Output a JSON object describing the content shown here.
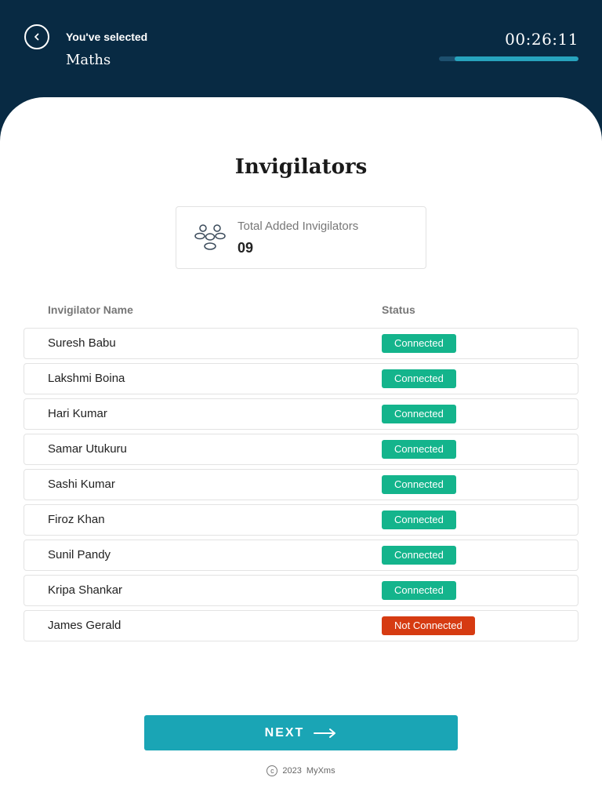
{
  "header": {
    "selected_label": "You've selected",
    "subject": "Maths",
    "timer": "00:26:11",
    "progress": 0.89,
    "back_icon": "chevron-left-icon"
  },
  "page": {
    "title": "Invigilators"
  },
  "summary": {
    "label": "Total Added Invigilators",
    "count": "09",
    "icon": "group-icon"
  },
  "table": {
    "columns": [
      "Invigilator Name",
      "Status"
    ],
    "rows": [
      {
        "name": "Suresh Babu",
        "status": "Connected"
      },
      {
        "name": "Lakshmi Boina",
        "status": "Connected"
      },
      {
        "name": "Hari Kumar",
        "status": "Connected"
      },
      {
        "name": "Samar Utukuru",
        "status": "Connected"
      },
      {
        "name": "Sashi Kumar",
        "status": "Connected"
      },
      {
        "name": "Firoz Khan",
        "status": "Connected"
      },
      {
        "name": "Sunil Pandy",
        "status": "Connected"
      },
      {
        "name": "Kripa Shankar",
        "status": "Connected"
      },
      {
        "name": "James Gerald",
        "status": "Not Connected"
      }
    ]
  },
  "colors": {
    "connected": "#14b48c",
    "not_connected": "#d63b12",
    "accent": "#1aa5b5",
    "header_bg": "#082a43"
  },
  "next_button": {
    "label": "NEXT",
    "icon": "arrow-right-icon"
  },
  "footer": {
    "icon": "copyright-icon",
    "year": "2023",
    "brand": "MyXms"
  }
}
